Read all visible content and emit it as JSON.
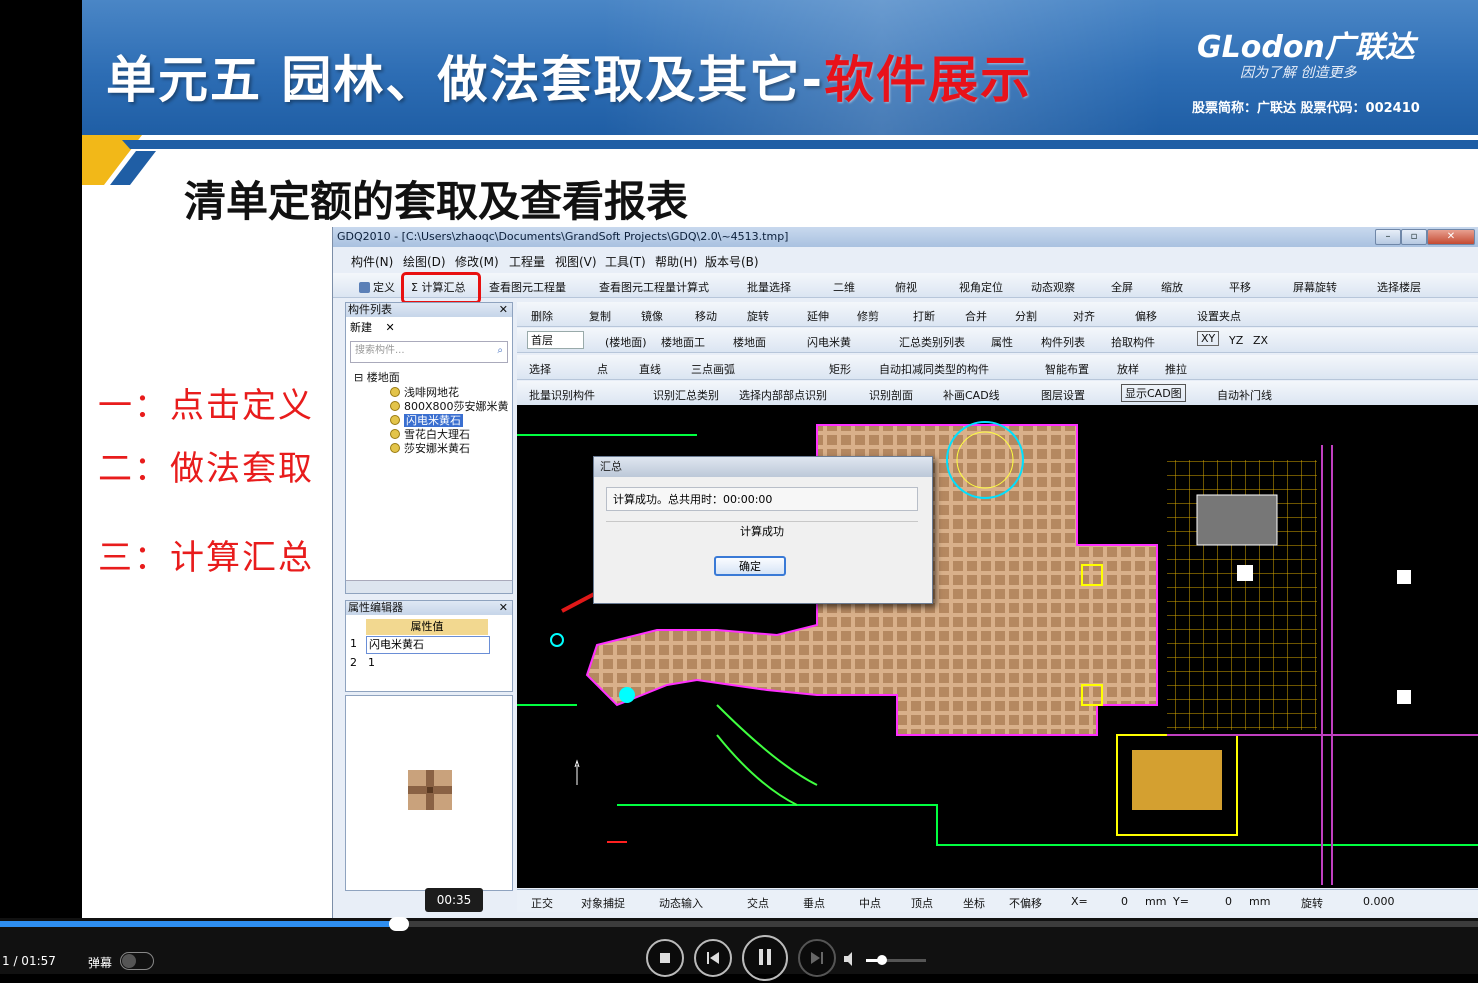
{
  "slide": {
    "title_main": "单元五  园林、做法套取及其它-",
    "title_red": "软件展示",
    "logo": "GLodon广联达",
    "slogan": "因为了解  创造更多",
    "stock_info": "股票简称：广联达   股票代码：002410",
    "subtitle": "清单定额的套取及查看报表",
    "steps": [
      "一：点击定义",
      "二：做法套取",
      "三：计算汇总"
    ]
  },
  "app": {
    "window_title": "GDQ2010 - [C:\\Users\\zhaoqc\\Documents\\GrandSoft Projects\\GDQ\\2.0\\~4513.tmp]",
    "menu": [
      "构件(N)",
      "绘图(D)",
      "修改(M)",
      "工程量",
      "视图(V)",
      "工具(T)",
      "帮助(H)",
      "版本号(B)"
    ],
    "toolbar1": [
      "定义",
      "Σ 计算汇总",
      "查看图元工程量",
      "查看图元工程量计算式",
      "批量选择",
      "二维",
      "俯视",
      "视角定位",
      "动态观察",
      "全屏",
      "缩放",
      "平移",
      "屏幕旋转",
      "选择楼层"
    ],
    "toolbar2": [
      "删除",
      "复制",
      "镜像",
      "移动",
      "旋转",
      "延伸",
      "修剪",
      "打断",
      "合并",
      "分割",
      "对齐",
      "偏移",
      "设置夹点"
    ],
    "toolbar3": [
      "首层",
      "(楼地面)",
      "楼地面工",
      "楼地面",
      "闪电米黄",
      "汇总类别列表",
      "属性",
      "构件列表",
      "拾取构件",
      "XY",
      "YZ",
      "ZX"
    ],
    "toolbar4": [
      "选择",
      "点",
      "直线",
      "三点画弧",
      "矩形",
      "自动扣减同类型的构件",
      "智能布置",
      "放样",
      "推拉"
    ],
    "toolbar5": [
      "批量识别构件",
      "识别汇总类别",
      "选择内部部点识别",
      "识别剖面",
      "补画CAD线",
      "图层设置",
      "显示CAD图",
      "自动补门线"
    ],
    "component_panel": {
      "title": "构件列表",
      "new_btn": "新建",
      "search_placeholder": "搜索构件...",
      "root": "楼地面",
      "items": [
        "浅啡网地花",
        "800X800莎安娜米黄",
        "闪电米黄石",
        "雪花白大理石",
        "莎安娜米黄石"
      ]
    },
    "property_panel": {
      "title": "属性编辑器",
      "header": "属性值",
      "rows": [
        {
          "n": "1",
          "v": "闪电米黄石"
        },
        {
          "n": "2",
          "v": "1"
        }
      ]
    },
    "dialog": {
      "title": "汇总",
      "message": "计算成功。总共用时：00:00:00",
      "status": "计算成功",
      "ok": "确定"
    },
    "status_bar": [
      "正交",
      "对象捕捉",
      "动态输入",
      "交点",
      "垂点",
      "中点",
      "顶点",
      "坐标",
      "不偏移",
      "X=",
      "0",
      "mm",
      "Y=",
      "0",
      "mm",
      "旋转",
      "0.000"
    ]
  },
  "player": {
    "tooltip_time": "00:35",
    "time_display": "1 / 01:57",
    "danmaku_label": "弹幕",
    "progress": 0.27
  }
}
